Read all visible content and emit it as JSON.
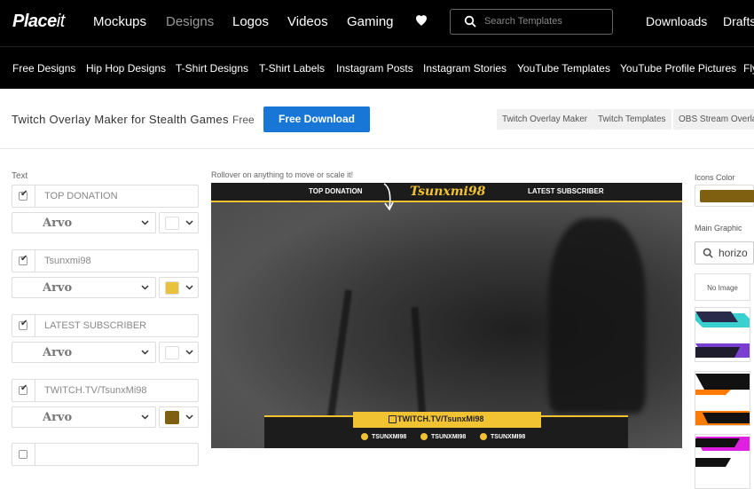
{
  "brand": {
    "logo_main": "Place",
    "logo_tail": "it"
  },
  "topnav": {
    "items": [
      "Mockups",
      "Designs",
      "Logos",
      "Videos",
      "Gaming"
    ],
    "search_placeholder": "Search Templates",
    "downloads": "Downloads",
    "drafts": "Drafts"
  },
  "subnav": {
    "items": [
      "Free Designs",
      "Hip Hop Designs",
      "T-Shirt Designs",
      "T-Shirt Labels",
      "Instagram Posts",
      "Instagram Stories",
      "YouTube Templates",
      "YouTube Profile Pictures",
      "Fly"
    ]
  },
  "titlebar": {
    "title": "Twitch Overlay Maker for Stealth Games",
    "price": "Free",
    "download_button": "Free Download",
    "tags": [
      "Twitch Overlay Maker",
      "Twitch Templates",
      "OBS Stream Overlay"
    ]
  },
  "editor": {
    "text_label": "Text",
    "fields": [
      {
        "checked": true,
        "value": "TOP DONATION",
        "font": "Arvo",
        "color": "#ffffff"
      },
      {
        "checked": true,
        "value": "Tsunxmi98",
        "font": "Arvo",
        "color": "#e8c23a"
      },
      {
        "checked": true,
        "value": "LATEST SUBSCRIBER",
        "font": "Arvo",
        "color": "#ffffff"
      },
      {
        "checked": true,
        "value": "TWITCH.TV/TsunxMi98",
        "font": "Arvo",
        "color": "#7f5f10"
      },
      {
        "checked": false,
        "value": ""
      }
    ]
  },
  "preview": {
    "hint": "Rollover on anything to move or scale it!",
    "top_donation": "TOP DONATION",
    "name": "Tsunxmi98",
    "latest_subscriber": "LATEST SUBSCRIBER",
    "twitch_url": "TWITCH.TV/TsunxMi98",
    "socials": [
      "TSUNXMI98",
      "TSUNXMI98",
      "TSUNXMI98"
    ]
  },
  "right_panel": {
    "icons_color_label": "Icons Color",
    "icons_color": "#7f5f10",
    "main_graphic_label": "Main Graphic",
    "search_value": "horizo",
    "no_image": "No Image"
  }
}
